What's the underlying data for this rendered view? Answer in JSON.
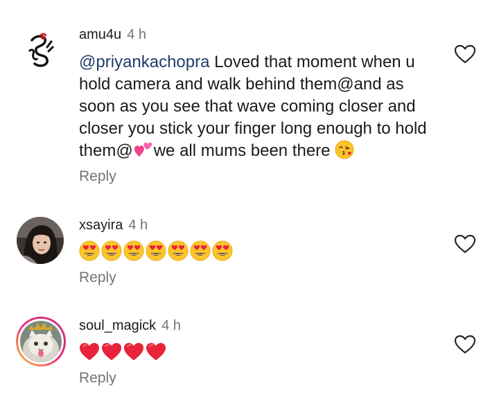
{
  "comments": [
    {
      "username": "amu4u",
      "time": "4 h",
      "mention": "@priyankachopra",
      "text_a": " Loved that moment when u hold camera and walk behind them@and as soon as you see that wave coming closer and closer you stick your finger long enough to hold them@",
      "text_b": "we all mums been there ",
      "inline_emojis": [
        "two-hearts-emoji",
        "face-blowing-kiss-emoji"
      ],
      "reply_label": "Reply"
    },
    {
      "username": "xsayira",
      "time": "4 h",
      "emojis": [
        "heart-eyes-emoji",
        "heart-eyes-emoji",
        "heart-eyes-emoji",
        "heart-eyes-emoji",
        "heart-eyes-emoji",
        "heart-eyes-emoji",
        "heart-eyes-emoji"
      ],
      "reply_label": "Reply"
    },
    {
      "username": "soul_magick",
      "time": "4 h",
      "emojis": [
        "red-heart-emoji",
        "red-heart-emoji",
        "red-heart-emoji",
        "red-heart-emoji"
      ],
      "reply_label": "Reply"
    }
  ],
  "icons": {
    "like": "heart-outline-icon"
  },
  "colors": {
    "mention": "#1f3d6b",
    "timestamp": "#737373",
    "story_ring_start": "#f9ce34",
    "story_ring_end": "#c13584"
  }
}
